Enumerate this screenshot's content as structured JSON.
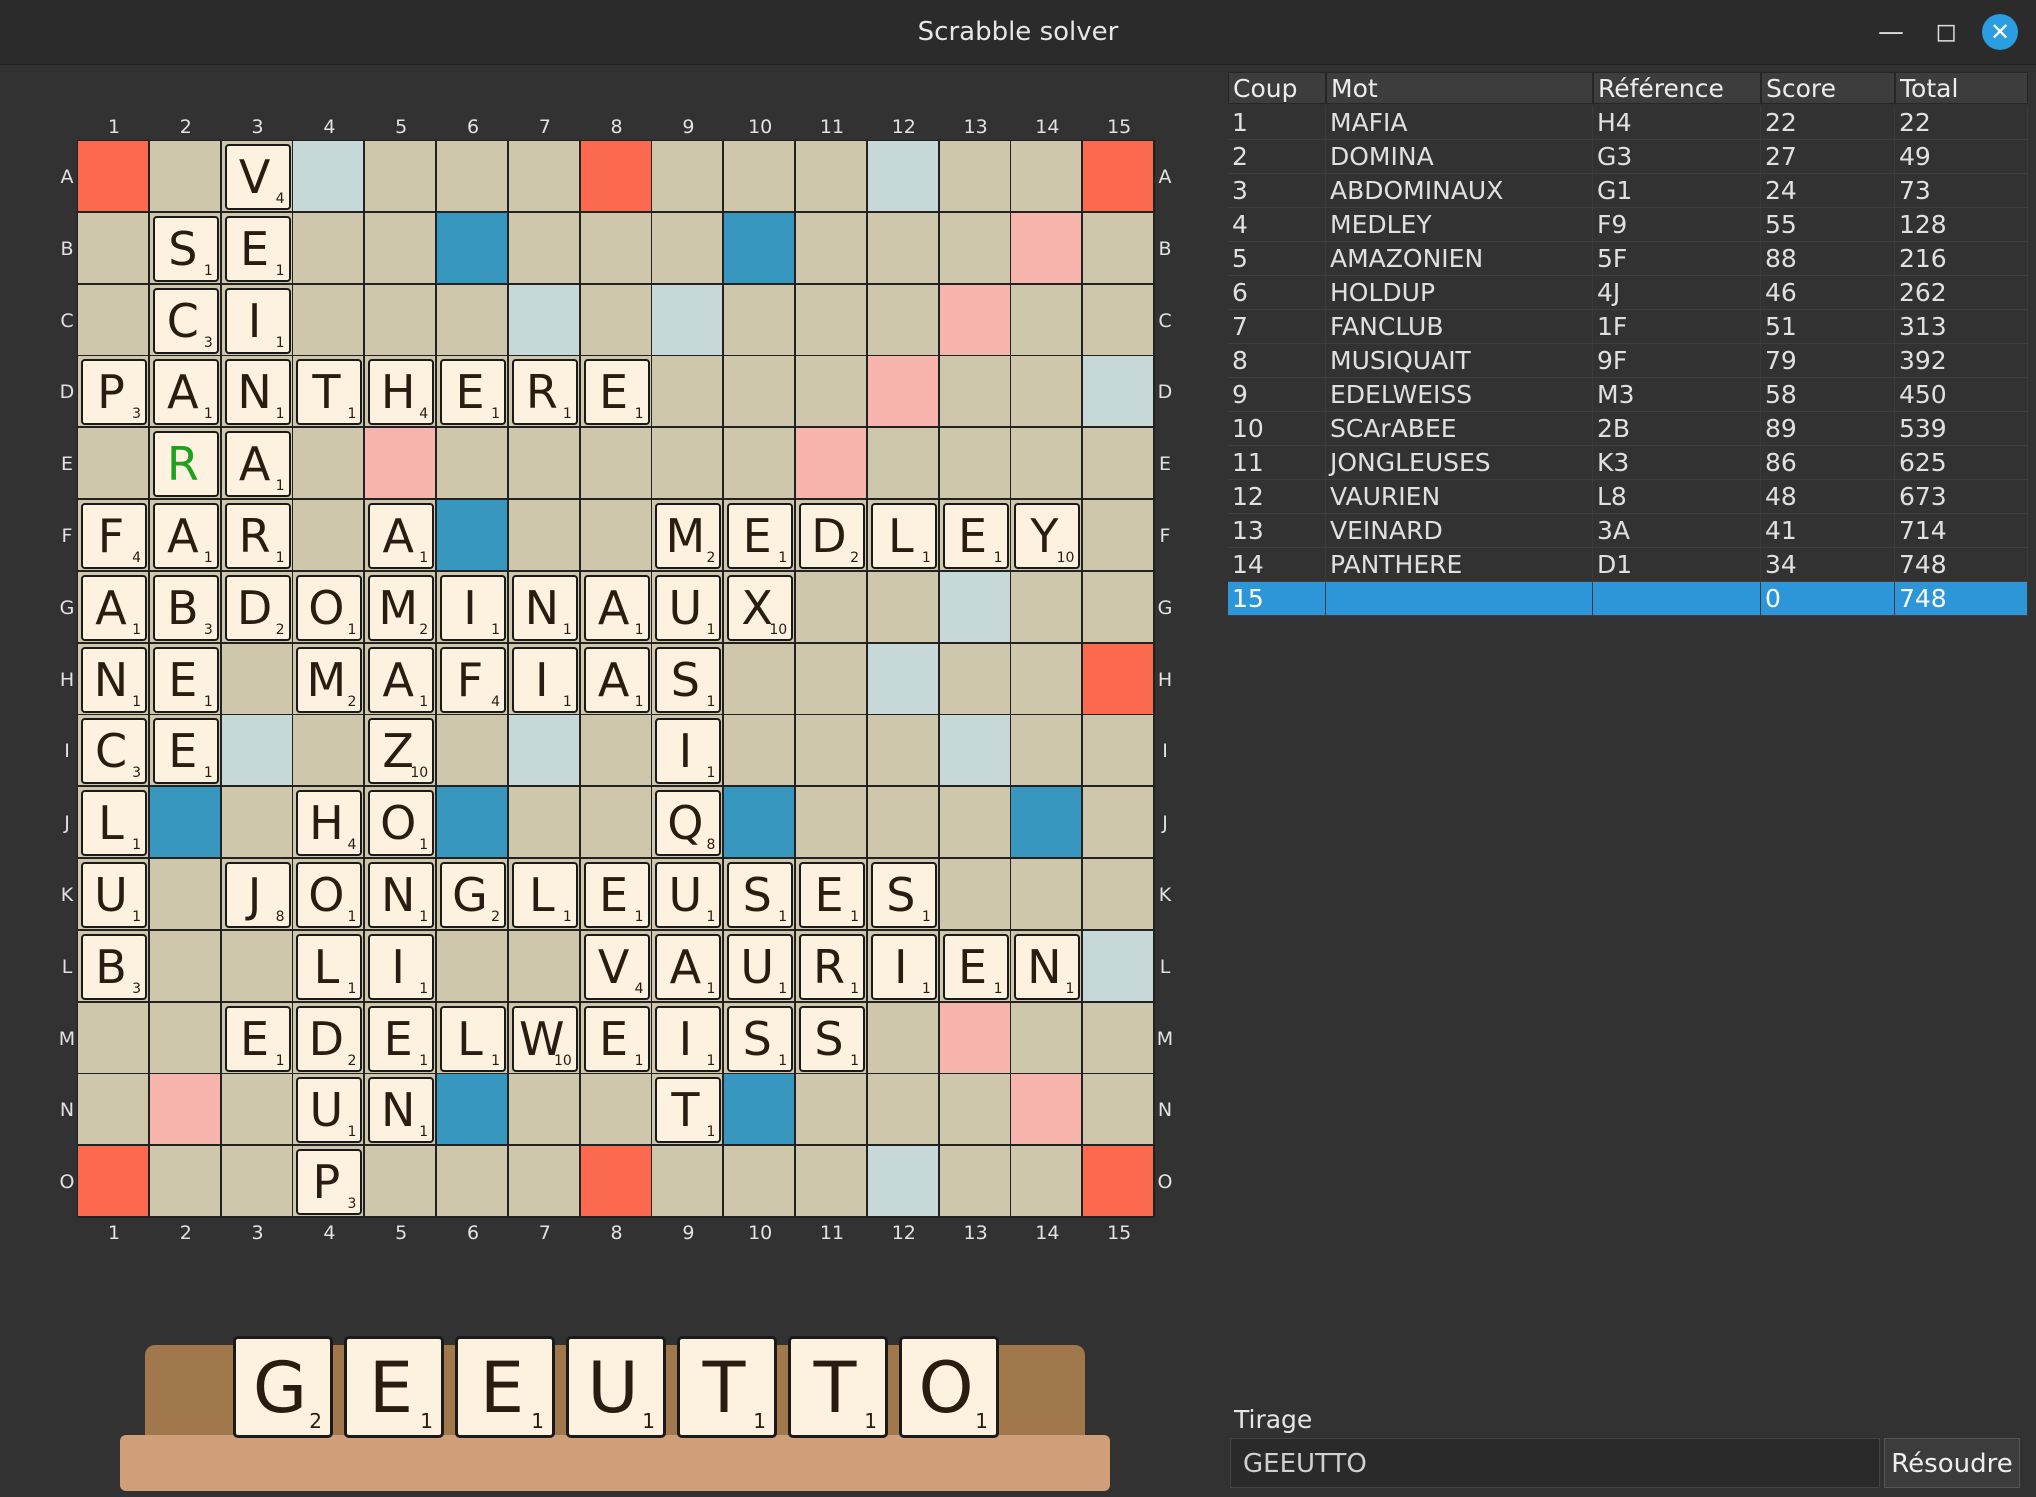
{
  "window": {
    "title": "Scrabble solver",
    "min_icon": "minimize-icon",
    "max_icon": "maximize-icon",
    "close_icon": "close-icon"
  },
  "board": {
    "col_labels": [
      "1",
      "2",
      "3",
      "4",
      "5",
      "6",
      "7",
      "8",
      "9",
      "10",
      "11",
      "12",
      "13",
      "14",
      "15"
    ],
    "row_labels": [
      "A",
      "B",
      "C",
      "D",
      "E",
      "F",
      "G",
      "H",
      "I",
      "J",
      "K",
      "L",
      "M",
      "N",
      "O"
    ],
    "premium_colors": {
      "normal": "#cfc7ab",
      "triple_word": "#fb6a4f",
      "double_word": "#f6b4ac",
      "triple_letter": "#3797bf",
      "double_letter": "#c6d9d8"
    },
    "premium_squares": {
      "tw": [
        [
          0,
          0
        ],
        [
          0,
          7
        ],
        [
          0,
          14
        ],
        [
          7,
          14
        ],
        [
          14,
          0
        ],
        [
          14,
          7
        ],
        [
          14,
          14
        ]
      ],
      "dw": [
        [
          1,
          13
        ],
        [
          2,
          12
        ],
        [
          3,
          11
        ],
        [
          4,
          4
        ],
        [
          4,
          10
        ],
        [
          12,
          12
        ],
        [
          13,
          1
        ],
        [
          13,
          13
        ]
      ],
      "tl": [
        [
          1,
          5
        ],
        [
          1,
          9
        ],
        [
          5,
          5
        ],
        [
          9,
          1
        ],
        [
          9,
          5
        ],
        [
          9,
          9
        ],
        [
          9,
          13
        ],
        [
          13,
          5
        ],
        [
          13,
          9
        ]
      ],
      "dl": [
        [
          0,
          3
        ],
        [
          0,
          11
        ],
        [
          2,
          6
        ],
        [
          2,
          8
        ],
        [
          3,
          14
        ],
        [
          6,
          12
        ],
        [
          7,
          11
        ],
        [
          8,
          2
        ],
        [
          8,
          6
        ],
        [
          8,
          12
        ],
        [
          11,
          14
        ],
        [
          14,
          11
        ]
      ]
    },
    "tiles": [
      {
        "r": 0,
        "c": 2,
        "l": "V",
        "p": "4"
      },
      {
        "r": 1,
        "c": 1,
        "l": "S",
        "p": "1"
      },
      {
        "r": 1,
        "c": 2,
        "l": "E",
        "p": "1"
      },
      {
        "r": 2,
        "c": 1,
        "l": "C",
        "p": "3"
      },
      {
        "r": 2,
        "c": 2,
        "l": "I",
        "p": "1"
      },
      {
        "r": 3,
        "c": 0,
        "l": "P",
        "p": "3"
      },
      {
        "r": 3,
        "c": 1,
        "l": "A",
        "p": "1"
      },
      {
        "r": 3,
        "c": 2,
        "l": "N",
        "p": "1"
      },
      {
        "r": 3,
        "c": 3,
        "l": "T",
        "p": "1"
      },
      {
        "r": 3,
        "c": 4,
        "l": "H",
        "p": "4"
      },
      {
        "r": 3,
        "c": 5,
        "l": "E",
        "p": "1"
      },
      {
        "r": 3,
        "c": 6,
        "l": "R",
        "p": "1"
      },
      {
        "r": 3,
        "c": 7,
        "l": "E",
        "p": "1"
      },
      {
        "r": 4,
        "c": 1,
        "l": "R",
        "p": "",
        "blank": true
      },
      {
        "r": 4,
        "c": 2,
        "l": "A",
        "p": "1"
      },
      {
        "r": 5,
        "c": 0,
        "l": "F",
        "p": "4"
      },
      {
        "r": 5,
        "c": 1,
        "l": "A",
        "p": "1"
      },
      {
        "r": 5,
        "c": 2,
        "l": "R",
        "p": "1"
      },
      {
        "r": 5,
        "c": 4,
        "l": "A",
        "p": "1"
      },
      {
        "r": 5,
        "c": 8,
        "l": "M",
        "p": "2"
      },
      {
        "r": 5,
        "c": 9,
        "l": "E",
        "p": "1"
      },
      {
        "r": 5,
        "c": 10,
        "l": "D",
        "p": "2"
      },
      {
        "r": 5,
        "c": 11,
        "l": "L",
        "p": "1"
      },
      {
        "r": 5,
        "c": 12,
        "l": "E",
        "p": "1"
      },
      {
        "r": 5,
        "c": 13,
        "l": "Y",
        "p": "10"
      },
      {
        "r": 6,
        "c": 0,
        "l": "A",
        "p": "1"
      },
      {
        "r": 6,
        "c": 1,
        "l": "B",
        "p": "3"
      },
      {
        "r": 6,
        "c": 2,
        "l": "D",
        "p": "2"
      },
      {
        "r": 6,
        "c": 3,
        "l": "O",
        "p": "1"
      },
      {
        "r": 6,
        "c": 4,
        "l": "M",
        "p": "2"
      },
      {
        "r": 6,
        "c": 5,
        "l": "I",
        "p": "1"
      },
      {
        "r": 6,
        "c": 6,
        "l": "N",
        "p": "1"
      },
      {
        "r": 6,
        "c": 7,
        "l": "A",
        "p": "1"
      },
      {
        "r": 6,
        "c": 8,
        "l": "U",
        "p": "1"
      },
      {
        "r": 6,
        "c": 9,
        "l": "X",
        "p": "10"
      },
      {
        "r": 7,
        "c": 0,
        "l": "N",
        "p": "1"
      },
      {
        "r": 7,
        "c": 1,
        "l": "E",
        "p": "1"
      },
      {
        "r": 7,
        "c": 3,
        "l": "M",
        "p": "2"
      },
      {
        "r": 7,
        "c": 4,
        "l": "A",
        "p": "1"
      },
      {
        "r": 7,
        "c": 5,
        "l": "F",
        "p": "4"
      },
      {
        "r": 7,
        "c": 6,
        "l": "I",
        "p": "1"
      },
      {
        "r": 7,
        "c": 7,
        "l": "A",
        "p": "1"
      },
      {
        "r": 7,
        "c": 8,
        "l": "S",
        "p": "1"
      },
      {
        "r": 8,
        "c": 0,
        "l": "C",
        "p": "3"
      },
      {
        "r": 8,
        "c": 1,
        "l": "E",
        "p": "1"
      },
      {
        "r": 8,
        "c": 4,
        "l": "Z",
        "p": "10"
      },
      {
        "r": 8,
        "c": 8,
        "l": "I",
        "p": "1"
      },
      {
        "r": 9,
        "c": 0,
        "l": "L",
        "p": "1"
      },
      {
        "r": 9,
        "c": 3,
        "l": "H",
        "p": "4"
      },
      {
        "r": 9,
        "c": 4,
        "l": "O",
        "p": "1"
      },
      {
        "r": 9,
        "c": 8,
        "l": "Q",
        "p": "8"
      },
      {
        "r": 10,
        "c": 0,
        "l": "U",
        "p": "1"
      },
      {
        "r": 10,
        "c": 2,
        "l": "J",
        "p": "8"
      },
      {
        "r": 10,
        "c": 3,
        "l": "O",
        "p": "1"
      },
      {
        "r": 10,
        "c": 4,
        "l": "N",
        "p": "1"
      },
      {
        "r": 10,
        "c": 5,
        "l": "G",
        "p": "2"
      },
      {
        "r": 10,
        "c": 6,
        "l": "L",
        "p": "1"
      },
      {
        "r": 10,
        "c": 7,
        "l": "E",
        "p": "1"
      },
      {
        "r": 10,
        "c": 8,
        "l": "U",
        "p": "1"
      },
      {
        "r": 10,
        "c": 9,
        "l": "S",
        "p": "1"
      },
      {
        "r": 10,
        "c": 10,
        "l": "E",
        "p": "1"
      },
      {
        "r": 10,
        "c": 11,
        "l": "S",
        "p": "1"
      },
      {
        "r": 11,
        "c": 0,
        "l": "B",
        "p": "3"
      },
      {
        "r": 11,
        "c": 3,
        "l": "L",
        "p": "1"
      },
      {
        "r": 11,
        "c": 4,
        "l": "I",
        "p": "1"
      },
      {
        "r": 11,
        "c": 7,
        "l": "V",
        "p": "4"
      },
      {
        "r": 11,
        "c": 8,
        "l": "A",
        "p": "1"
      },
      {
        "r": 11,
        "c": 9,
        "l": "U",
        "p": "1"
      },
      {
        "r": 11,
        "c": 10,
        "l": "R",
        "p": "1"
      },
      {
        "r": 11,
        "c": 11,
        "l": "I",
        "p": "1"
      },
      {
        "r": 11,
        "c": 12,
        "l": "E",
        "p": "1"
      },
      {
        "r": 11,
        "c": 13,
        "l": "N",
        "p": "1"
      },
      {
        "r": 12,
        "c": 2,
        "l": "E",
        "p": "1"
      },
      {
        "r": 12,
        "c": 3,
        "l": "D",
        "p": "2"
      },
      {
        "r": 12,
        "c": 4,
        "l": "E",
        "p": "1"
      },
      {
        "r": 12,
        "c": 5,
        "l": "L",
        "p": "1"
      },
      {
        "r": 12,
        "c": 6,
        "l": "W",
        "p": "10"
      },
      {
        "r": 12,
        "c": 7,
        "l": "E",
        "p": "1"
      },
      {
        "r": 12,
        "c": 8,
        "l": "I",
        "p": "1"
      },
      {
        "r": 12,
        "c": 9,
        "l": "S",
        "p": "1"
      },
      {
        "r": 12,
        "c": 10,
        "l": "S",
        "p": "1"
      },
      {
        "r": 13,
        "c": 3,
        "l": "U",
        "p": "1"
      },
      {
        "r": 13,
        "c": 4,
        "l": "N",
        "p": "1"
      },
      {
        "r": 13,
        "c": 8,
        "l": "T",
        "p": "1"
      },
      {
        "r": 14,
        "c": 3,
        "l": "P",
        "p": "3"
      }
    ]
  },
  "rack": [
    {
      "l": "G",
      "p": "2"
    },
    {
      "l": "E",
      "p": "1"
    },
    {
      "l": "E",
      "p": "1"
    },
    {
      "l": "U",
      "p": "1"
    },
    {
      "l": "T",
      "p": "1"
    },
    {
      "l": "T",
      "p": "1"
    },
    {
      "l": "O",
      "p": "1"
    }
  ],
  "table": {
    "headers": [
      "Coup",
      "Mot",
      "Référence",
      "Score",
      "Total"
    ],
    "rows": [
      [
        "1",
        "MAFIA",
        "H4",
        "22",
        "22"
      ],
      [
        "2",
        "DOMINA",
        "G3",
        "27",
        "49"
      ],
      [
        "3",
        "ABDOMINAUX",
        "G1",
        "24",
        "73"
      ],
      [
        "4",
        "MEDLEY",
        "F9",
        "55",
        "128"
      ],
      [
        "5",
        "AMAZONIEN",
        "5F",
        "88",
        "216"
      ],
      [
        "6",
        "HOLDUP",
        "4J",
        "46",
        "262"
      ],
      [
        "7",
        "FANCLUB",
        "1F",
        "51",
        "313"
      ],
      [
        "8",
        "MUSIQUAIT",
        "9F",
        "79",
        "392"
      ],
      [
        "9",
        "EDELWEISS",
        "M3",
        "58",
        "450"
      ],
      [
        "10",
        "SCArABEE",
        "2B",
        "89",
        "539"
      ],
      [
        "11",
        "JONGLEUSES",
        "K3",
        "86",
        "625"
      ],
      [
        "12",
        "VAURIEN",
        "L8",
        "48",
        "673"
      ],
      [
        "13",
        "VEINARD",
        "3A",
        "41",
        "714"
      ],
      [
        "14",
        "PANTHERE",
        "D1",
        "34",
        "748"
      ],
      [
        "15",
        "",
        "",
        "0",
        "748"
      ]
    ],
    "selected_row": 14
  },
  "tirage": {
    "label": "Tirage",
    "value": "GEEUTTO",
    "button": "Résoudre"
  }
}
